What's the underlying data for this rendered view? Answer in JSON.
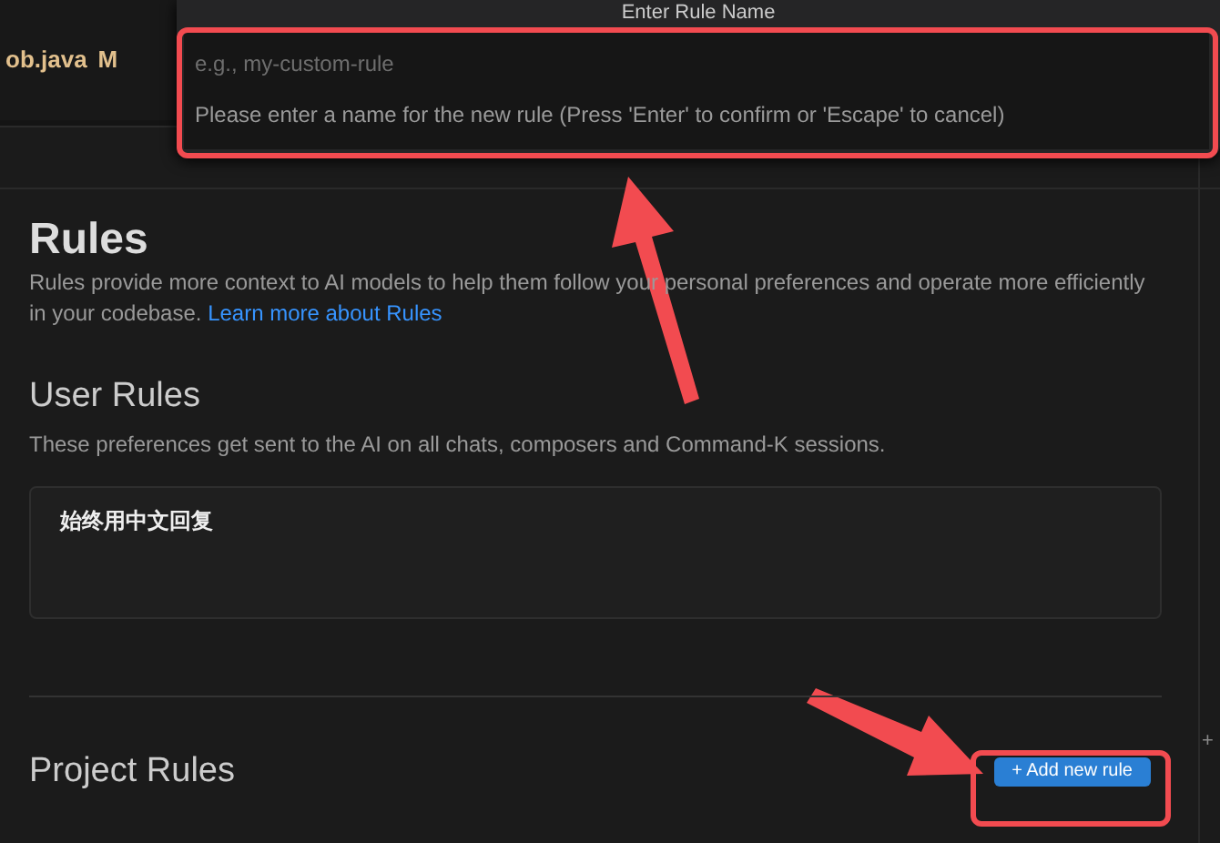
{
  "editor_tab": {
    "filename": "ob.java",
    "git_status": "M"
  },
  "quick_input": {
    "title": "Enter Rule Name",
    "placeholder": "e.g., my-custom-rule",
    "message": "Please enter a name for the new rule (Press 'Enter' to confirm or 'Escape' to cancel)"
  },
  "rules": {
    "title": "Rules",
    "description": "Rules provide more context to AI models to help them follow your personal preferences and operate more efficiently in your codebase.",
    "link": "Learn more about Rules"
  },
  "user_rules": {
    "title": "User Rules",
    "description": "These preferences get sent to the AI on all chats, composers and Command-K sessions.",
    "value": "始终用中文回复"
  },
  "project_rules": {
    "title": "Project Rules",
    "add_button": "+ Add new rule"
  },
  "side_button": "+"
}
